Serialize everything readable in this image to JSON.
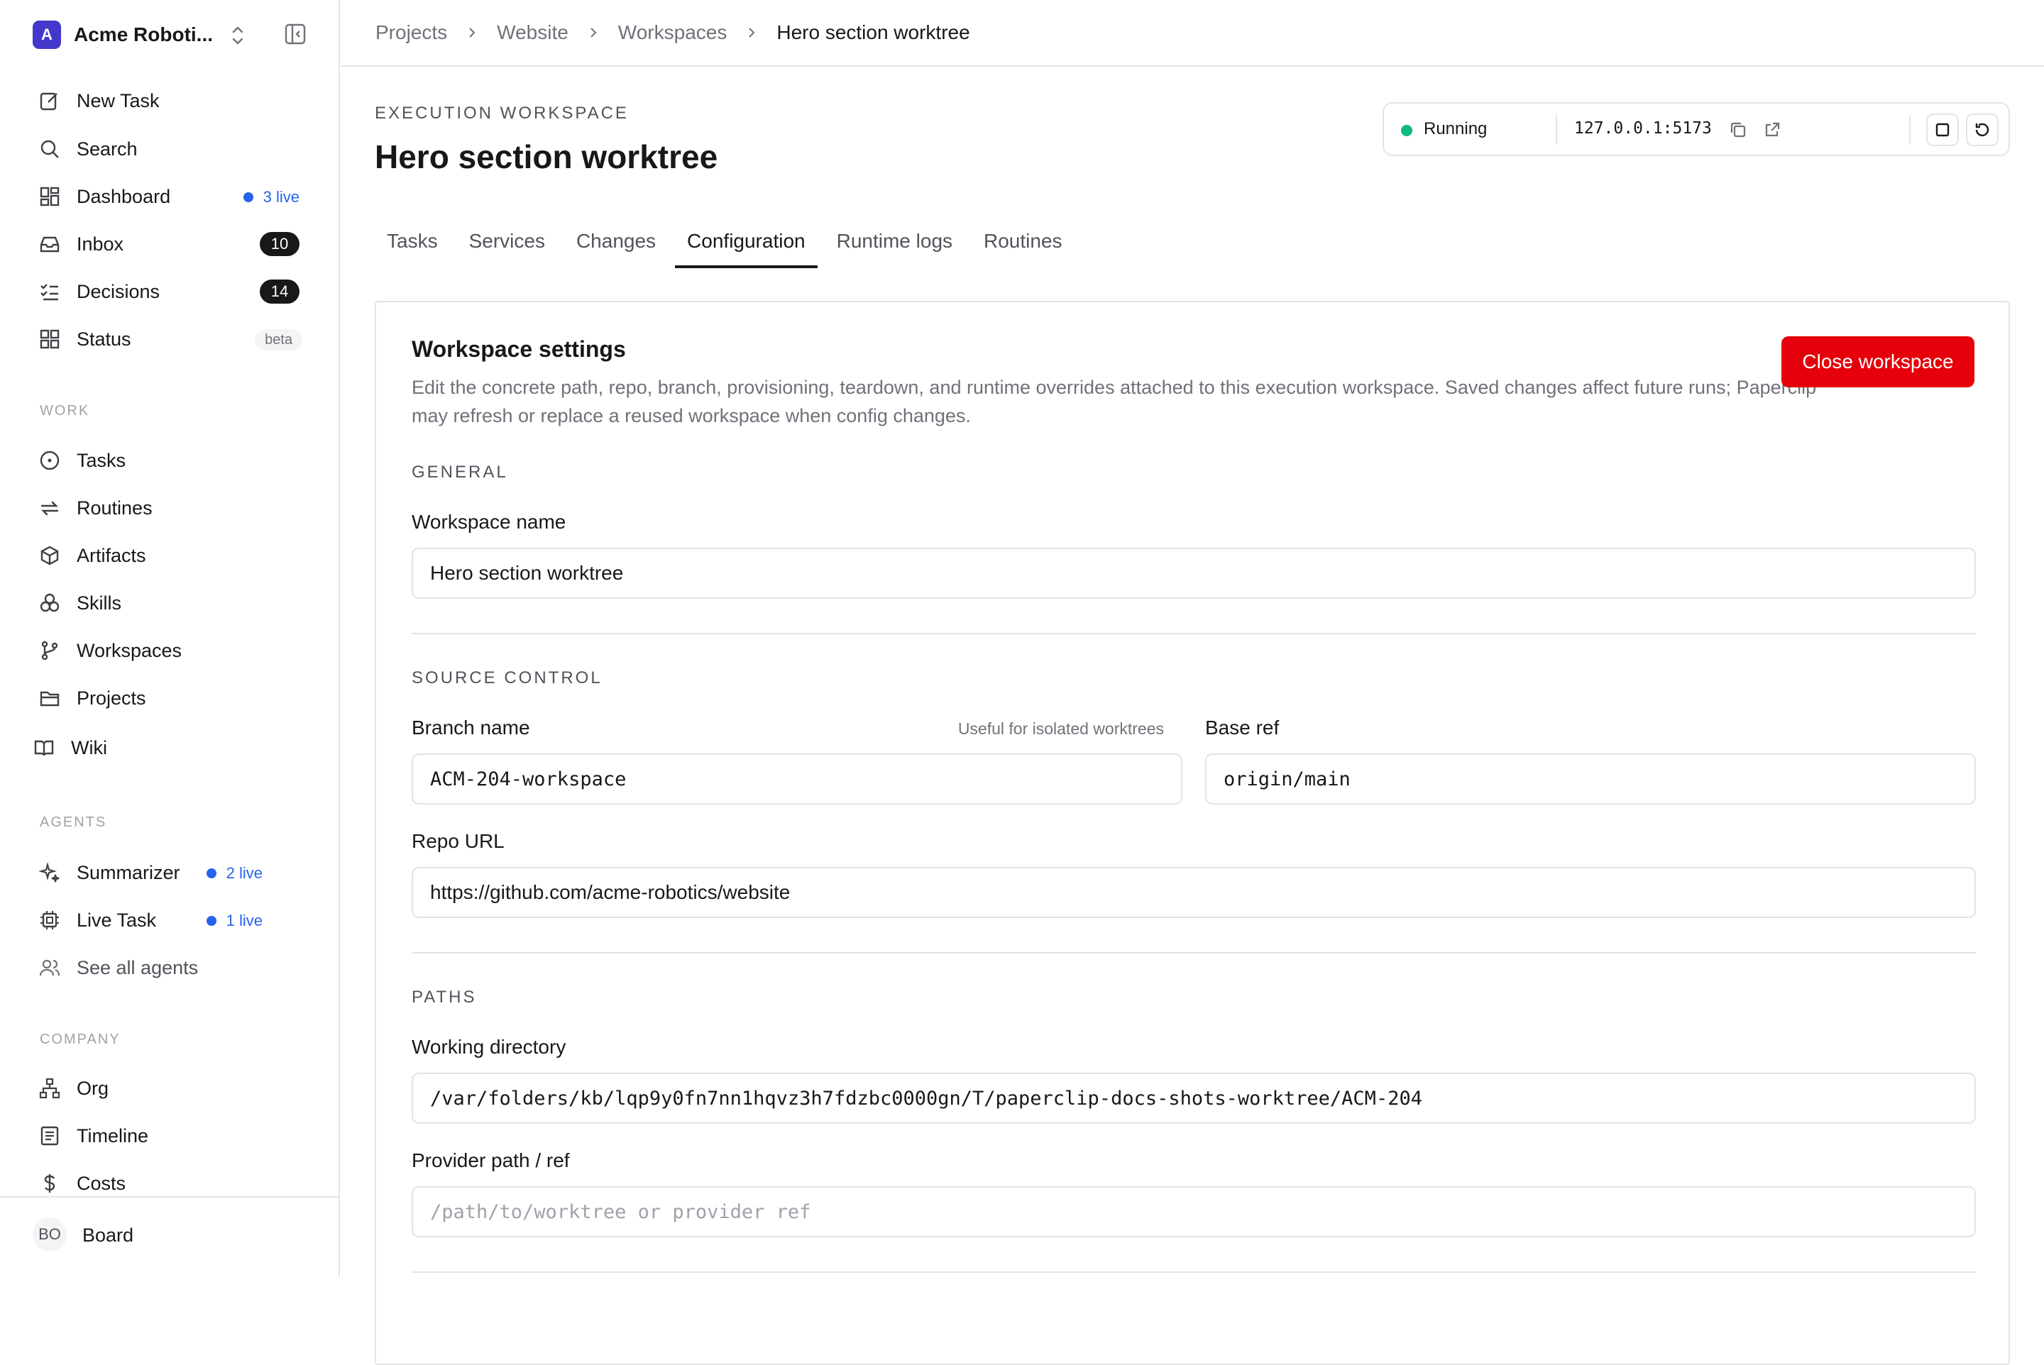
{
  "company": {
    "initial": "A",
    "name": "Acme Roboti..."
  },
  "nav": {
    "new_task": "New Task",
    "search": "Search",
    "dashboard": "Dashboard",
    "dashboard_live": "3 live",
    "inbox": "Inbox",
    "inbox_count": "10",
    "decisions": "Decisions",
    "decisions_count": "14",
    "status": "Status",
    "status_badge": "beta"
  },
  "work": {
    "heading": "WORK",
    "items": [
      "Tasks",
      "Routines",
      "Artifacts",
      "Skills",
      "Workspaces",
      "Projects",
      "Wiki"
    ]
  },
  "agents": {
    "heading": "AGENTS",
    "summarizer": "Summarizer",
    "summarizer_live": "2 live",
    "live_task": "Live Task",
    "live_task_live": "1 live",
    "see_all": "See all agents"
  },
  "company_section": {
    "heading": "COMPANY",
    "items": [
      "Org",
      "Timeline",
      "Costs"
    ]
  },
  "user": {
    "initials": "BO",
    "name": "Board"
  },
  "breadcrumb": [
    "Projects",
    "Website",
    "Workspaces",
    "Hero section worktree"
  ],
  "header": {
    "eyebrow": "EXECUTION WORKSPACE",
    "title": "Hero section worktree"
  },
  "runtime": {
    "status": "Running",
    "status_color": "#10b981",
    "address": "127.0.0.1:5173"
  },
  "tabs": [
    "Tasks",
    "Services",
    "Changes",
    "Configuration",
    "Runtime logs",
    "Routines"
  ],
  "active_tab": "Configuration",
  "settings": {
    "title": "Workspace settings",
    "description": "Edit the concrete path, repo, branch, provisioning, teardown, and runtime overrides attached to this execution workspace. Saved changes affect future runs; Paperclip may refresh or replace a reused workspace when config changes.",
    "close_button": "Close workspace",
    "close_button_color": "#e5000b",
    "general": {
      "heading": "GENERAL",
      "name_label": "Workspace name",
      "name_value": "Hero section worktree"
    },
    "source_control": {
      "heading": "SOURCE CONTROL",
      "branch_label": "Branch name",
      "branch_hint": "Useful for isolated worktrees",
      "branch_value": "ACM-204-workspace",
      "base_ref_label": "Base ref",
      "base_ref_value": "origin/main",
      "repo_label": "Repo URL",
      "repo_value": "https://github.com/acme-robotics/website"
    },
    "paths": {
      "heading": "PATHS",
      "workdir_label": "Working directory",
      "workdir_value": "/var/folders/kb/lqp9y0fn7nn1hqvz3h7fdzbc0000gn/T/paperclip-docs-shots-worktree/ACM-204",
      "provider_label": "Provider path / ref",
      "provider_placeholder": "/path/to/worktree or provider ref"
    }
  }
}
